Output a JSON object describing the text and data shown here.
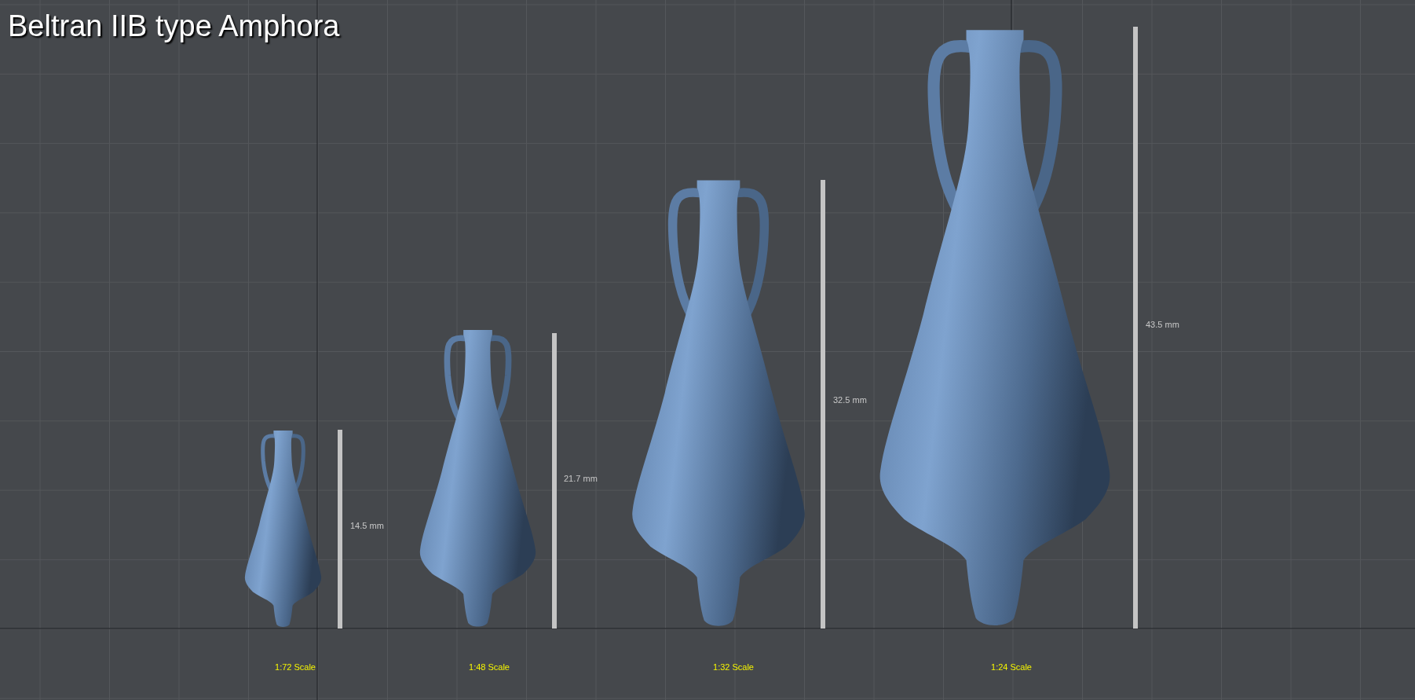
{
  "title": "Beltran IIB type Amphora",
  "models": [
    {
      "measurement": "14.5 mm",
      "scale": "1:72 Scale"
    },
    {
      "measurement": "21.7 mm",
      "scale": "1:48 Scale"
    },
    {
      "measurement": "32.5 mm",
      "scale": "1:32 Scale"
    },
    {
      "measurement": "43.5 mm",
      "scale": "1:24 Scale"
    }
  ]
}
